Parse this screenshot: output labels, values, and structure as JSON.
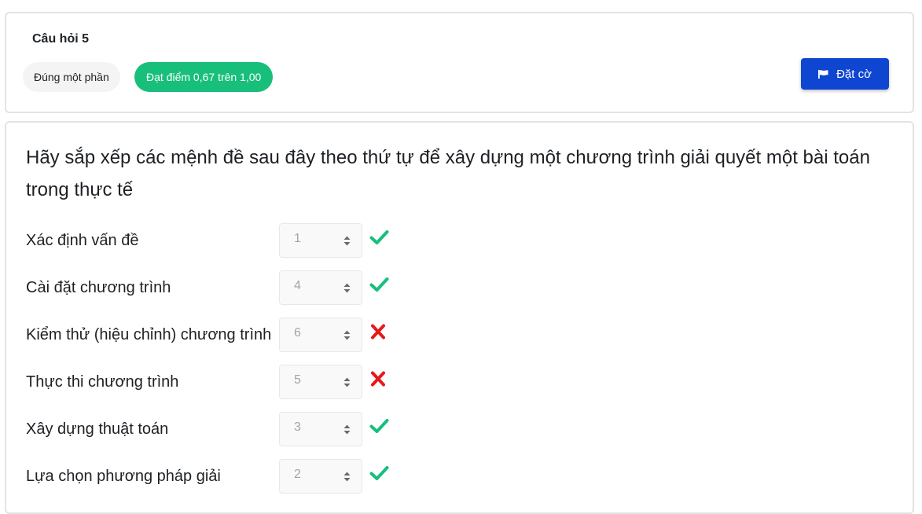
{
  "question": {
    "title": "Câu hỏi 5",
    "state": "Đúng một phần",
    "grade": "Đạt điểm 0,67 trên 1,00",
    "flag_label": "Đặt cờ",
    "text": "Hãy sắp xếp các mệnh đề sau đây theo thứ tự để xây dựng một chương trình giải quyết một bài toán trong thực tế"
  },
  "colors": {
    "grade_pill": "#17bf7a",
    "flag_button": "#0f46d1",
    "correct": "#17bf7a",
    "incorrect": "#e61919"
  },
  "items": [
    {
      "label": "Xác định vấn đề",
      "value": "1",
      "result": "correct",
      "icon": "check-icon"
    },
    {
      "label": "Cài đặt chương trình",
      "value": "4",
      "result": "correct",
      "icon": "check-icon"
    },
    {
      "label": "Kiểm thử (hiệu chỉnh) chương trình",
      "value": "6",
      "result": "incorrect",
      "icon": "cross-icon"
    },
    {
      "label": "Thực thi chương trình",
      "value": "5",
      "result": "incorrect",
      "icon": "cross-icon"
    },
    {
      "label": "Xây dựng thuật toán",
      "value": "3",
      "result": "correct",
      "icon": "check-icon"
    },
    {
      "label": "Lựa chọn phương pháp giải",
      "value": "2",
      "result": "correct",
      "icon": "check-icon"
    }
  ]
}
